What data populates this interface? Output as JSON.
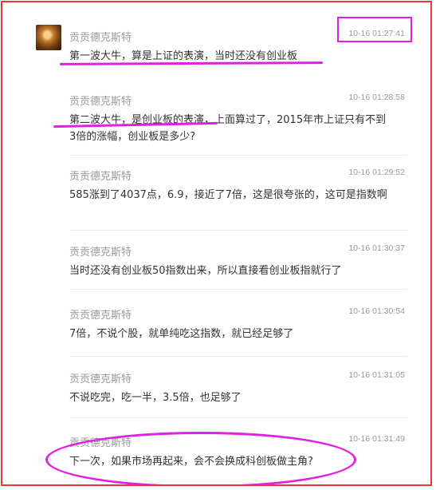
{
  "thread": {
    "messages": [
      {
        "username": "贡贡德克斯特",
        "time": "10-16 01:27:41",
        "text": "第一波大牛，算是上证的表演，当时还没有创业板"
      },
      {
        "username": "贡贡德克斯特",
        "time": "10-16 01:28:58",
        "text": "第二波大牛，是创业板的表演，上面算过了，2015年市上证只有不到3倍的涨幅，创业板是多少?"
      },
      {
        "username": "贡贡德克斯特",
        "time": "10-16 01:29:52",
        "text": "585涨到了4037点，6.9，接近了7倍，这是很夸张的，这可是指数啊"
      },
      {
        "username": "贡贡德克斯特",
        "time": "10-16 01:30:37",
        "text": "当时还没有创业板50指数出来，所以直接看创业板指就行了"
      },
      {
        "username": "贡贡德克斯特",
        "time": "10-16 01:30:54",
        "text": "7倍，不说个股，就单纯吃这指数，就已经足够了"
      },
      {
        "username": "贡贡德克斯特",
        "time": "10-16 01:31:05",
        "text": "不说吃完，吃一半，3.5倍，也足够了"
      },
      {
        "username": "贡贡德克斯特",
        "time": "10-16 01:31:49",
        "text": "下一次，如果市场再起来，会不会换成科创板做主角?"
      }
    ]
  },
  "colors": {
    "frame": "#e53935",
    "annotation": "#e020e0",
    "username": "#999999",
    "text": "#333333"
  },
  "icons": {
    "avatar": "user-avatar-photo"
  }
}
